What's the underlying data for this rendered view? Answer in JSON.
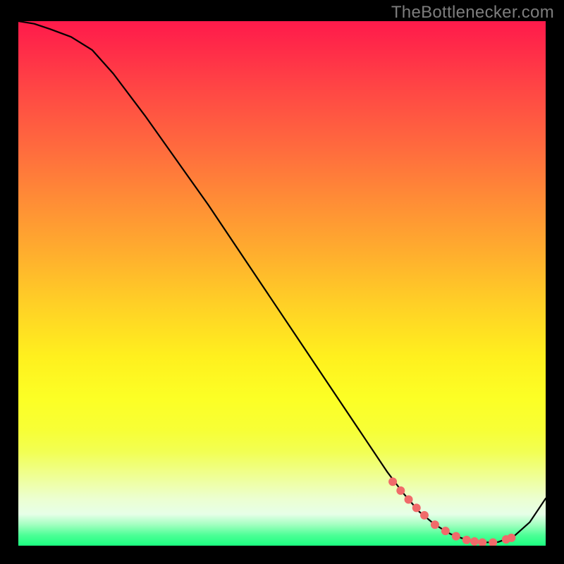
{
  "watermark": "TheBottlenecker.com",
  "chart_data": {
    "type": "line",
    "title": "",
    "xlabel": "",
    "ylabel": "",
    "xlim": [
      0,
      100
    ],
    "ylim": [
      0,
      100
    ],
    "x": [
      0,
      3,
      6,
      10,
      14,
      18,
      24,
      30,
      36,
      42,
      48,
      54,
      60,
      66,
      70,
      73,
      76,
      79,
      82,
      85,
      88,
      91,
      94,
      97,
      100
    ],
    "values": [
      100,
      99.5,
      98.5,
      97,
      94.5,
      90,
      82,
      73.5,
      65,
      56,
      47,
      38,
      29,
      20,
      14,
      10,
      6.5,
      4,
      2.2,
      1.1,
      0.6,
      0.7,
      1.8,
      4.5,
      9
    ],
    "markers": {
      "x": [
        71,
        72.5,
        74,
        75.5,
        77,
        79,
        81,
        83,
        85,
        86.5,
        88,
        90,
        92.5,
        93.5
      ],
      "y": [
        12.2,
        10.5,
        8.8,
        7.2,
        5.8,
        4.0,
        2.8,
        1.8,
        1.1,
        0.8,
        0.6,
        0.6,
        1.2,
        1.5
      ],
      "color": "#f06a6a",
      "radius": 6
    },
    "line_color": "#000000",
    "line_width": 2.2
  }
}
